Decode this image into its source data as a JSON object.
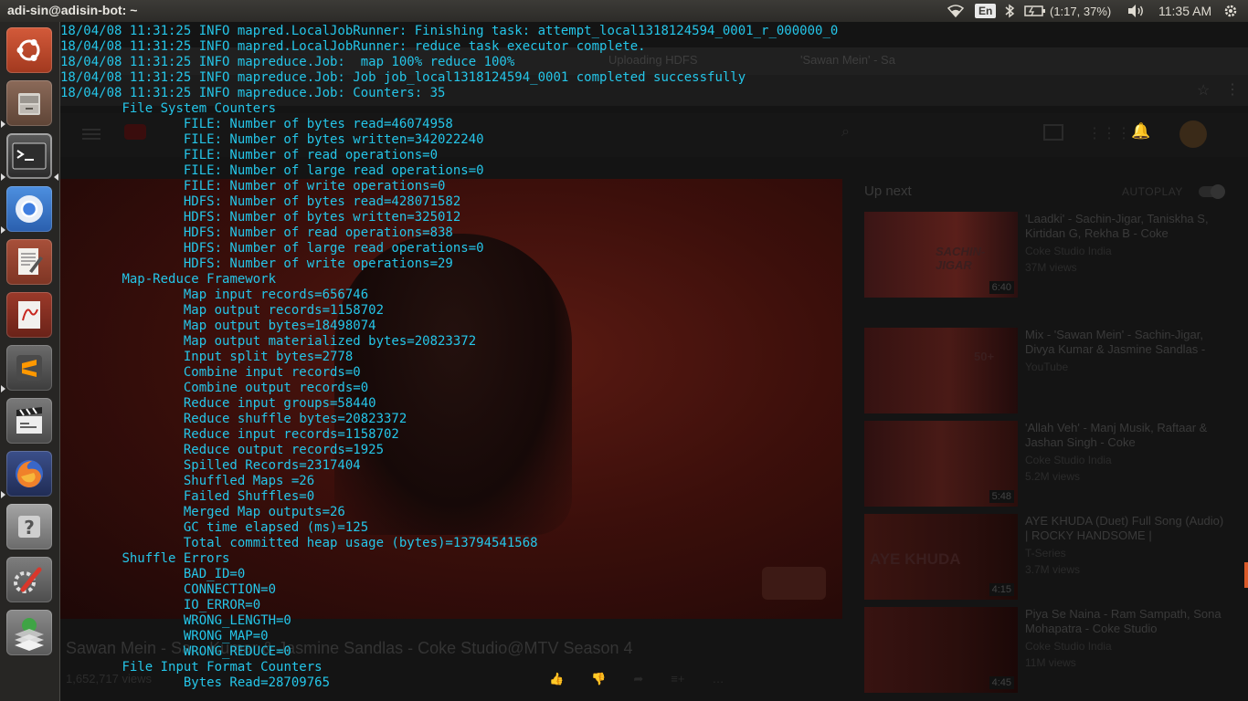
{
  "panel": {
    "window_title": "adi-sin@adisin-bot: ~",
    "keyboard_layout": "En",
    "battery_text": "(1:17, 37%)",
    "clock": "11:35 AM"
  },
  "launcher": {
    "items": [
      {
        "name": "ubuntu-dash",
        "icon": "ubuntu-logo-icon"
      },
      {
        "name": "files",
        "icon": "file-cabinet-icon"
      },
      {
        "name": "terminal",
        "icon": "terminal-icon"
      },
      {
        "name": "chromium",
        "icon": "chromium-icon"
      },
      {
        "name": "text-editor",
        "icon": "text-editor-icon"
      },
      {
        "name": "document-viewer",
        "icon": "pdf-viewer-icon"
      },
      {
        "name": "sublime-text",
        "icon": "sublime-text-icon"
      },
      {
        "name": "video-editor",
        "icon": "clapperboard-icon"
      },
      {
        "name": "firefox",
        "icon": "firefox-icon"
      },
      {
        "name": "help",
        "icon": "help-icon"
      },
      {
        "name": "system-settings",
        "icon": "settings-wrench-icon"
      },
      {
        "name": "software-updater",
        "icon": "updater-icon"
      }
    ]
  },
  "browser_background": {
    "tabs": [
      {
        "label": "Uploading HDFS"
      },
      {
        "label": "'Sawan Mein' - Sa"
      }
    ],
    "video_title": "Sawan Mein - Sa... Kumar & Jasmine Sandlas - Coke Studio@MTV Season 4",
    "views": "1,652,717 views",
    "autoplay_label": "AUTOPLAY",
    "up_next_label": "Up next",
    "recommendations": [
      {
        "title": "'Laadki' - Sachin-Jigar, Taniskha S, Kirtidan G, Rekha B - Coke",
        "channel": "Coke Studio India",
        "meta": "37M views",
        "thumb_text": "SACHIN-JIGAR",
        "duration": "6:40"
      },
      {
        "title": "Mix - 'Sawan Mein' - Sachin-Jigar, Divya Kumar & Jasmine Sandlas -",
        "channel": "YouTube",
        "meta": "",
        "thumb_text": "50+",
        "duration": ""
      },
      {
        "title": "'Allah Veh' - Manj Musik, Raftaar & Jashan Singh - Coke",
        "channel": "Coke Studio India",
        "meta": "5.2M views",
        "thumb_text": "",
        "duration": "5:48"
      },
      {
        "title": "AYE KHUDA (Duet) Full Song (Audio) | ROCKY HANDSOME |",
        "channel": "T-Series",
        "meta": "3.7M views",
        "thumb_text": "AYE KHUDA",
        "duration": "4:15"
      },
      {
        "title": "Piya Se Naina - Ram Sampath, Sona Mohapatra - Coke Studio",
        "channel": "Coke Studio India",
        "meta": "11M views",
        "thumb_text": "",
        "duration": "4:45"
      }
    ]
  },
  "terminal": {
    "lines": [
      "18/04/08 11:31:25 INFO mapred.LocalJobRunner: Finishing task: attempt_local1318124594_0001_r_000000_0",
      "18/04/08 11:31:25 INFO mapred.LocalJobRunner: reduce task executor complete.",
      "18/04/08 11:31:25 INFO mapreduce.Job:  map 100% reduce 100%",
      "18/04/08 11:31:25 INFO mapreduce.Job: Job job_local1318124594_0001 completed successfully",
      "18/04/08 11:31:25 INFO mapreduce.Job: Counters: 35",
      "\tFile System Counters",
      "\t\tFILE: Number of bytes read=46074958",
      "\t\tFILE: Number of bytes written=342022240",
      "\t\tFILE: Number of read operations=0",
      "\t\tFILE: Number of large read operations=0",
      "\t\tFILE: Number of write operations=0",
      "\t\tHDFS: Number of bytes read=428071582",
      "\t\tHDFS: Number of bytes written=325012",
      "\t\tHDFS: Number of read operations=838",
      "\t\tHDFS: Number of large read operations=0",
      "\t\tHDFS: Number of write operations=29",
      "\tMap-Reduce Framework",
      "\t\tMap input records=656746",
      "\t\tMap output records=1158702",
      "\t\tMap output bytes=18498074",
      "\t\tMap output materialized bytes=20823372",
      "\t\tInput split bytes=2778",
      "\t\tCombine input records=0",
      "\t\tCombine output records=0",
      "\t\tReduce input groups=58440",
      "\t\tReduce shuffle bytes=20823372",
      "\t\tReduce input records=1158702",
      "\t\tReduce output records=1925",
      "\t\tSpilled Records=2317404",
      "\t\tShuffled Maps =26",
      "\t\tFailed Shuffles=0",
      "\t\tMerged Map outputs=26",
      "\t\tGC time elapsed (ms)=125",
      "\t\tTotal committed heap usage (bytes)=13794541568",
      "\tShuffle Errors",
      "\t\tBAD_ID=0",
      "\t\tCONNECTION=0",
      "\t\tIO_ERROR=0",
      "\t\tWRONG_LENGTH=0",
      "\t\tWRONG_MAP=0",
      "\t\tWRONG_REDUCE=0",
      "\tFile Input Format Counters",
      "\t\tBytes Read=28709765"
    ]
  },
  "colors": {
    "terminal_text": "#25c6e9",
    "panel_bg": "#3c3b37",
    "launcher_bg": "#282624"
  }
}
